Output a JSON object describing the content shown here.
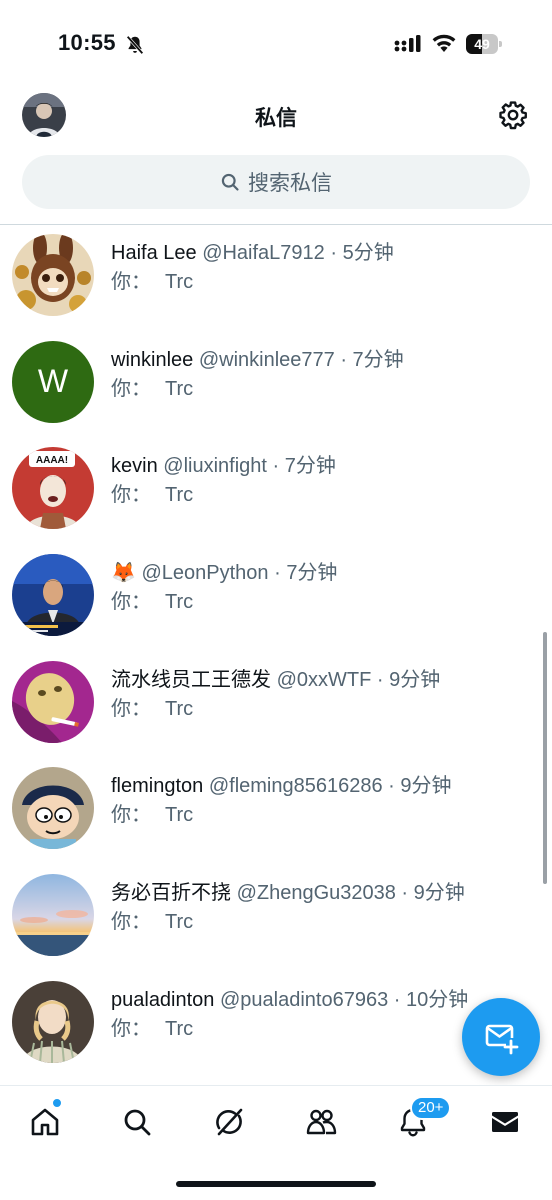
{
  "status_bar": {
    "time": "10:55",
    "battery_level": "49"
  },
  "header": {
    "title": "私信"
  },
  "search": {
    "placeholder": "搜索私信"
  },
  "conversations": [
    {
      "name": "Haifa Lee",
      "handle": "@HaifaL7912",
      "time": "5分钟",
      "prefix": "你：",
      "message": "Trc",
      "avatar": "toy-figure-avatar"
    },
    {
      "name": "winkinlee",
      "handle": "@winkinlee777",
      "time": "7分钟",
      "prefix": "你：",
      "message": "Trc",
      "avatar_letter": "W",
      "avatar_color": "#2e6a12"
    },
    {
      "name": "kevin",
      "handle": "@liuxinfight",
      "time": "7分钟",
      "prefix": "你：",
      "message": "Trc",
      "avatar": "cartoon-man-avatar",
      "avatar_text": "AAAA!"
    },
    {
      "name": "🦊",
      "handle": "@LeonPython",
      "time": "7分钟",
      "prefix": "你：",
      "message": "Trc",
      "avatar": "tv-anchor-avatar"
    },
    {
      "name": "流水线员工王德发",
      "handle": "@0xxWTF",
      "time": "9分钟",
      "prefix": "你：",
      "message": "Trc",
      "avatar": "smoking-face-avatar"
    },
    {
      "name": "flemington",
      "handle": "@fleming85616286",
      "time": "9分钟",
      "prefix": "你：",
      "message": "Trc",
      "avatar": "cartoon-boy-avatar"
    },
    {
      "name": "务必百折不挠",
      "handle": "@ZhengGu32038",
      "time": "9分钟",
      "prefix": "你：",
      "message": "Trc",
      "avatar": "sunset-sky-avatar"
    },
    {
      "name": "pualadinton",
      "handle": "@pualadinto67963",
      "time": "10分钟",
      "prefix": "你：",
      "message": "Trc",
      "avatar": "vintage-girl-avatar"
    }
  ],
  "tab_bar": {
    "notifications_badge": "20+",
    "active_tab": "messages"
  },
  "colors": {
    "accent": "#1d9bf0",
    "secondary_text": "#536471"
  }
}
